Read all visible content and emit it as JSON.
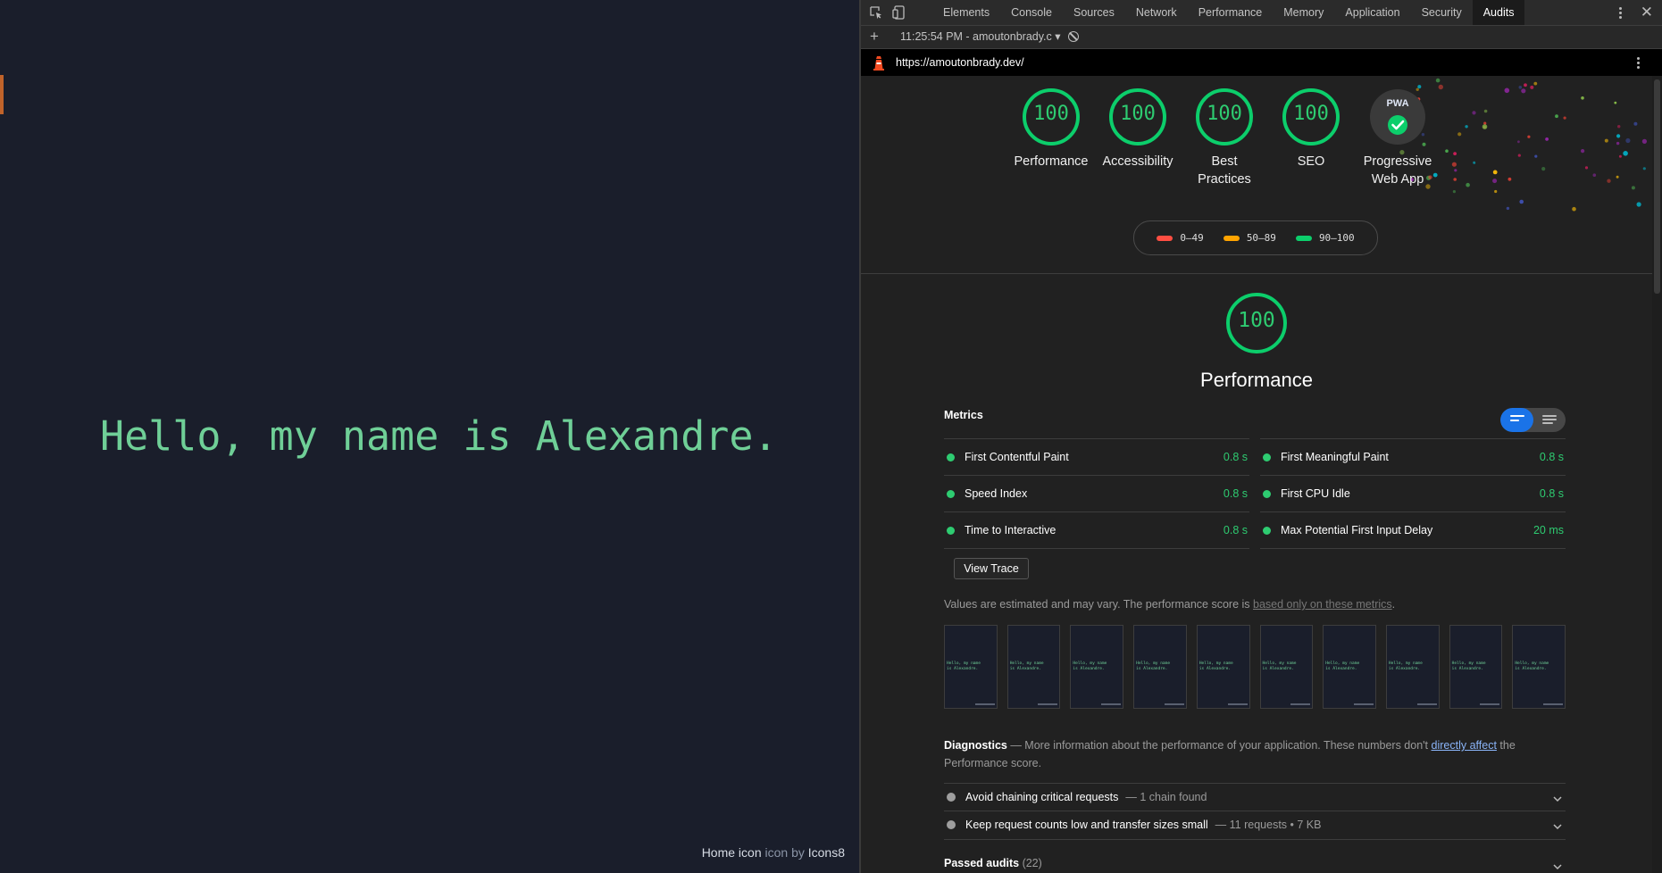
{
  "page": {
    "hello_text": "Hello, my name is Alexandre.",
    "credit_part1": "Home icon",
    "credit_part2": "icon by",
    "credit_part3": "Icons8"
  },
  "devtools": {
    "tabs": [
      "Elements",
      "Console",
      "Sources",
      "Network",
      "Performance",
      "Memory",
      "Application",
      "Security",
      "Audits"
    ],
    "active_tab": "Audits",
    "run_label": "11:25:54 PM - amoutonbrady.c",
    "url": "https://amoutonbrady.dev/"
  },
  "gauges": [
    {
      "score": "100",
      "label": "Performance"
    },
    {
      "score": "100",
      "label": "Accessibility"
    },
    {
      "score": "100",
      "label_line1": "Best",
      "label_line2": "Practices"
    },
    {
      "score": "100",
      "label": "SEO"
    },
    {
      "badge": "PWA",
      "label_line1": "Progressive",
      "label_line2": "Web App"
    }
  ],
  "legend": [
    {
      "range": "0–49",
      "color": "#ff4e42"
    },
    {
      "range": "50–89",
      "color": "#ffa400"
    },
    {
      "range": "90–100",
      "color": "#0cce6b"
    }
  ],
  "performance": {
    "score": "100",
    "title": "Performance",
    "metrics_heading": "Metrics",
    "metrics_left": [
      {
        "name": "First Contentful Paint",
        "value": "0.8 s"
      },
      {
        "name": "Speed Index",
        "value": "0.8 s"
      },
      {
        "name": "Time to Interactive",
        "value": "0.8 s"
      }
    ],
    "metrics_right": [
      {
        "name": "First Meaningful Paint",
        "value": "0.8 s"
      },
      {
        "name": "First CPU Idle",
        "value": "0.8 s"
      },
      {
        "name": "Max Potential First Input Delay",
        "value": "20 ms"
      }
    ],
    "view_trace": "View Trace",
    "estimated_text": "Values are estimated and may vary. The performance score is ",
    "estimated_link": "based only on these metrics",
    "estimated_end": ".",
    "filmstrip_frame_text": "Hello, my name is Alexandre.",
    "diagnostics_title": "Diagnostics",
    "diagnostics_text1": " — More information about the performance of your application. These numbers don't ",
    "diagnostics_link": "directly affect",
    "diagnostics_text2": " the Performance score.",
    "audits": [
      {
        "title": "Avoid chaining critical requests",
        "detail": "— 1 chain found"
      },
      {
        "title": "Keep request counts low and transfer sizes small",
        "detail": "— 11 requests • 7 KB"
      }
    ],
    "passed_label": "Passed audits",
    "passed_count": "(22)"
  },
  "colors": {
    "score_green": "#2ecc71",
    "page_bg": "#1a1e2b",
    "hello_green": "#6fcf97",
    "link_blue": "#8ab4f8"
  }
}
